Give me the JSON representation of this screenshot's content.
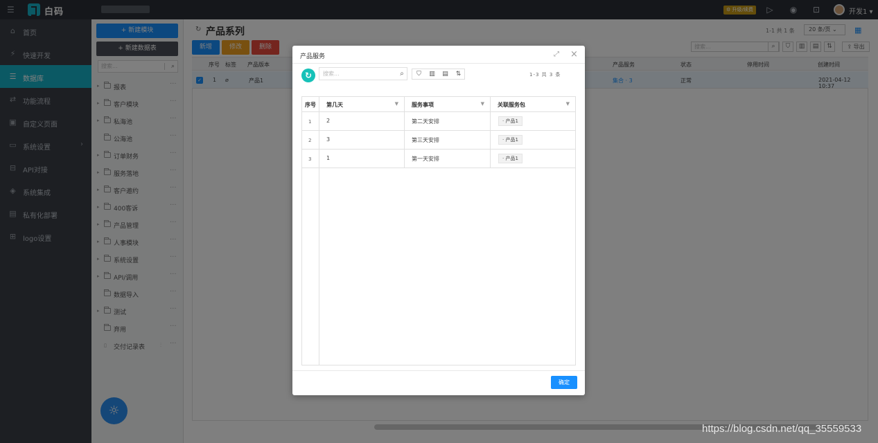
{
  "topbar": {
    "brand": "白码",
    "upgrade_label": "⚙ 升级/续费",
    "user_name": "开发1 ▾"
  },
  "nav": {
    "items": [
      {
        "label": "首页",
        "icon": "home-icon"
      },
      {
        "label": "快速开发",
        "icon": "lightning-icon"
      },
      {
        "label": "数据库",
        "icon": "database-icon"
      },
      {
        "label": "功能流程",
        "icon": "flow-icon"
      },
      {
        "label": "自定义页面",
        "icon": "page-icon"
      },
      {
        "label": "系统设置",
        "icon": "monitor-icon"
      },
      {
        "label": "API对接",
        "icon": "api-icon"
      },
      {
        "label": "系统集成",
        "icon": "integration-icon"
      },
      {
        "label": "私有化部署",
        "icon": "server-icon"
      },
      {
        "label": "logo设置",
        "icon": "logo-icon"
      }
    ],
    "active_index": 2
  },
  "tree": {
    "new_module": "+ 新建模块",
    "new_table": "+ 新建数据表",
    "search_placeholder": "搜索...",
    "items": [
      {
        "label": "报表"
      },
      {
        "label": "客户模块"
      },
      {
        "label": "私海池"
      },
      {
        "label": "公海池"
      },
      {
        "label": "订单财务"
      },
      {
        "label": "服务落地"
      },
      {
        "label": "客户邀约"
      },
      {
        "label": "400客诉"
      },
      {
        "label": "产品管理"
      },
      {
        "label": "人事模块"
      },
      {
        "label": "系统设置"
      },
      {
        "label": "API/调用"
      },
      {
        "label": "数据导入"
      },
      {
        "label": "测试"
      },
      {
        "label": "弃用"
      },
      {
        "label": "交付记录表"
      }
    ]
  },
  "main": {
    "title": "产品系列",
    "count": "1-1 共 1 条",
    "page_size": "20 条/页 ⌄",
    "btn_add": "新增",
    "btn_edit": "修改",
    "btn_delete": "删除",
    "search_placeholder": "搜索...",
    "export": "⇪ 导出",
    "columns": [
      "序号",
      "标签",
      "产品版本",
      "产品服务",
      "状态",
      "停用时间",
      "创建时间"
    ],
    "row": {
      "index": "1",
      "version": "产品1",
      "service": "集合 · 3",
      "status": "正常",
      "created": "2021-04-12 10:37"
    }
  },
  "modal": {
    "title": "产品服务",
    "search_placeholder": "搜索...",
    "count": "1-3 共 3 条",
    "columns": [
      "序号",
      "第几天",
      "服务事项",
      "关联服务包"
    ],
    "rows": [
      {
        "index": "1",
        "day": "2",
        "item": "第二天安排",
        "pkg": "· 产品1"
      },
      {
        "index": "2",
        "day": "3",
        "item": "第三天安排",
        "pkg": "· 产品1"
      },
      {
        "index": "3",
        "day": "1",
        "item": "第一天安排",
        "pkg": "· 产品1"
      }
    ],
    "ok_label": "确定"
  },
  "watermark": "https://blog.csdn.net/qq_35559533"
}
